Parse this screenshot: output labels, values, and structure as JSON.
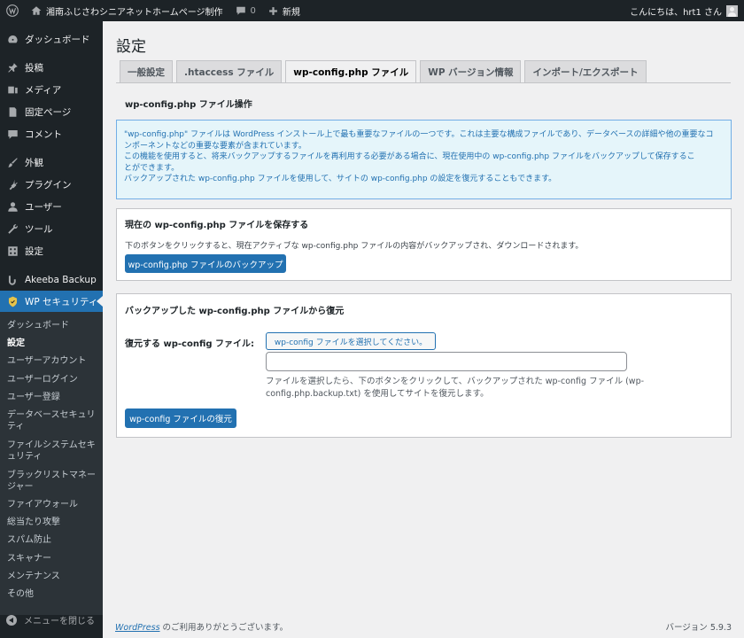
{
  "adminbar": {
    "site_name": "湘南ふじさわシニアネットホームページ制作",
    "comments_count": "0",
    "new_label": "新規",
    "greeting": "こんにちは、hrt1 さん"
  },
  "sidebar": {
    "items": [
      {
        "label": "ダッシュボード",
        "icon": "dashboard-icon"
      },
      {
        "label": "投稿",
        "icon": "pin-icon"
      },
      {
        "label": "メディア",
        "icon": "media-icon"
      },
      {
        "label": "固定ページ",
        "icon": "page-icon"
      },
      {
        "label": "コメント",
        "icon": "comment-icon"
      },
      {
        "label": "外観",
        "icon": "brush-icon"
      },
      {
        "label": "プラグイン",
        "icon": "plugin-icon"
      },
      {
        "label": "ユーザー",
        "icon": "user-icon"
      },
      {
        "label": "ツール",
        "icon": "wrench-icon"
      },
      {
        "label": "設定",
        "icon": "settings-icon"
      },
      {
        "label": "Akeeba Backup",
        "icon": "akeeba-icon"
      },
      {
        "label": "WP セキュリティ",
        "icon": "shield-icon"
      }
    ],
    "submenu": [
      "ダッシュボード",
      "設定",
      "ユーザーアカウント",
      "ユーザーログイン",
      "ユーザー登録",
      "データベースセキュリティ",
      "ファイルシステムセキュリティ",
      "ブラックリストマネージャー",
      "ファイアウォール",
      "総当たり攻撃",
      "スパム防止",
      "スキャナー",
      "メンテナンス",
      "その他"
    ],
    "collapse_label": "メニューを閉じる"
  },
  "main": {
    "title": "設定",
    "tabs": [
      "一般設定",
      ".htaccess ファイル",
      "wp-config.php ファイル",
      "WP バージョン情報",
      "インポート/エクスポート"
    ],
    "section_title": "wp-config.php ファイル操作",
    "info": {
      "line1": "\"wp-config.php\" ファイルは WordPress インストール上で最も重要なファイルの一つです。これは主要な構成ファイルであり、データベースの詳細や他の重要なコ",
      "line2": "ンポーネントなどの重要な要素が含まれています。",
      "line3": "この機能を使用すると、将来バックアップするファイルを再利用する必要がある場合に、現在使用中の wp-config.php ファイルをバックアップして保存するこ",
      "line4": "とができます。",
      "line5": "バックアップされた wp-config.php ファイルを使用して、サイトの wp-config.php の設定を復元することもできます。"
    },
    "save_panel": {
      "title": "現在の wp-config.php ファイルを保存する",
      "desc": "下のボタンをクリックすると、現在アクティブな wp-config.php ファイルの内容がバックアップされ、ダウンロードされます。",
      "button": "wp-config.php ファイルのバックアップ"
    },
    "restore_panel": {
      "title": "バックアップした wp-config.php ファイルから復元",
      "field_label": "復元する wp-config ファイル:",
      "select_button": "wp-config ファイルを選択してください。",
      "input_value": "",
      "desc": "ファイルを選択したら、下のボタンをクリックして、バックアップされた wp-config ファイル (wp-config.php.backup.txt) を使用してサイトを復元します。",
      "button": "wp-config ファイルの復元"
    }
  },
  "footer": {
    "link": "WordPress",
    "thanks": " のご利用ありがとうございます。",
    "version": "バージョン 5.9.3"
  }
}
